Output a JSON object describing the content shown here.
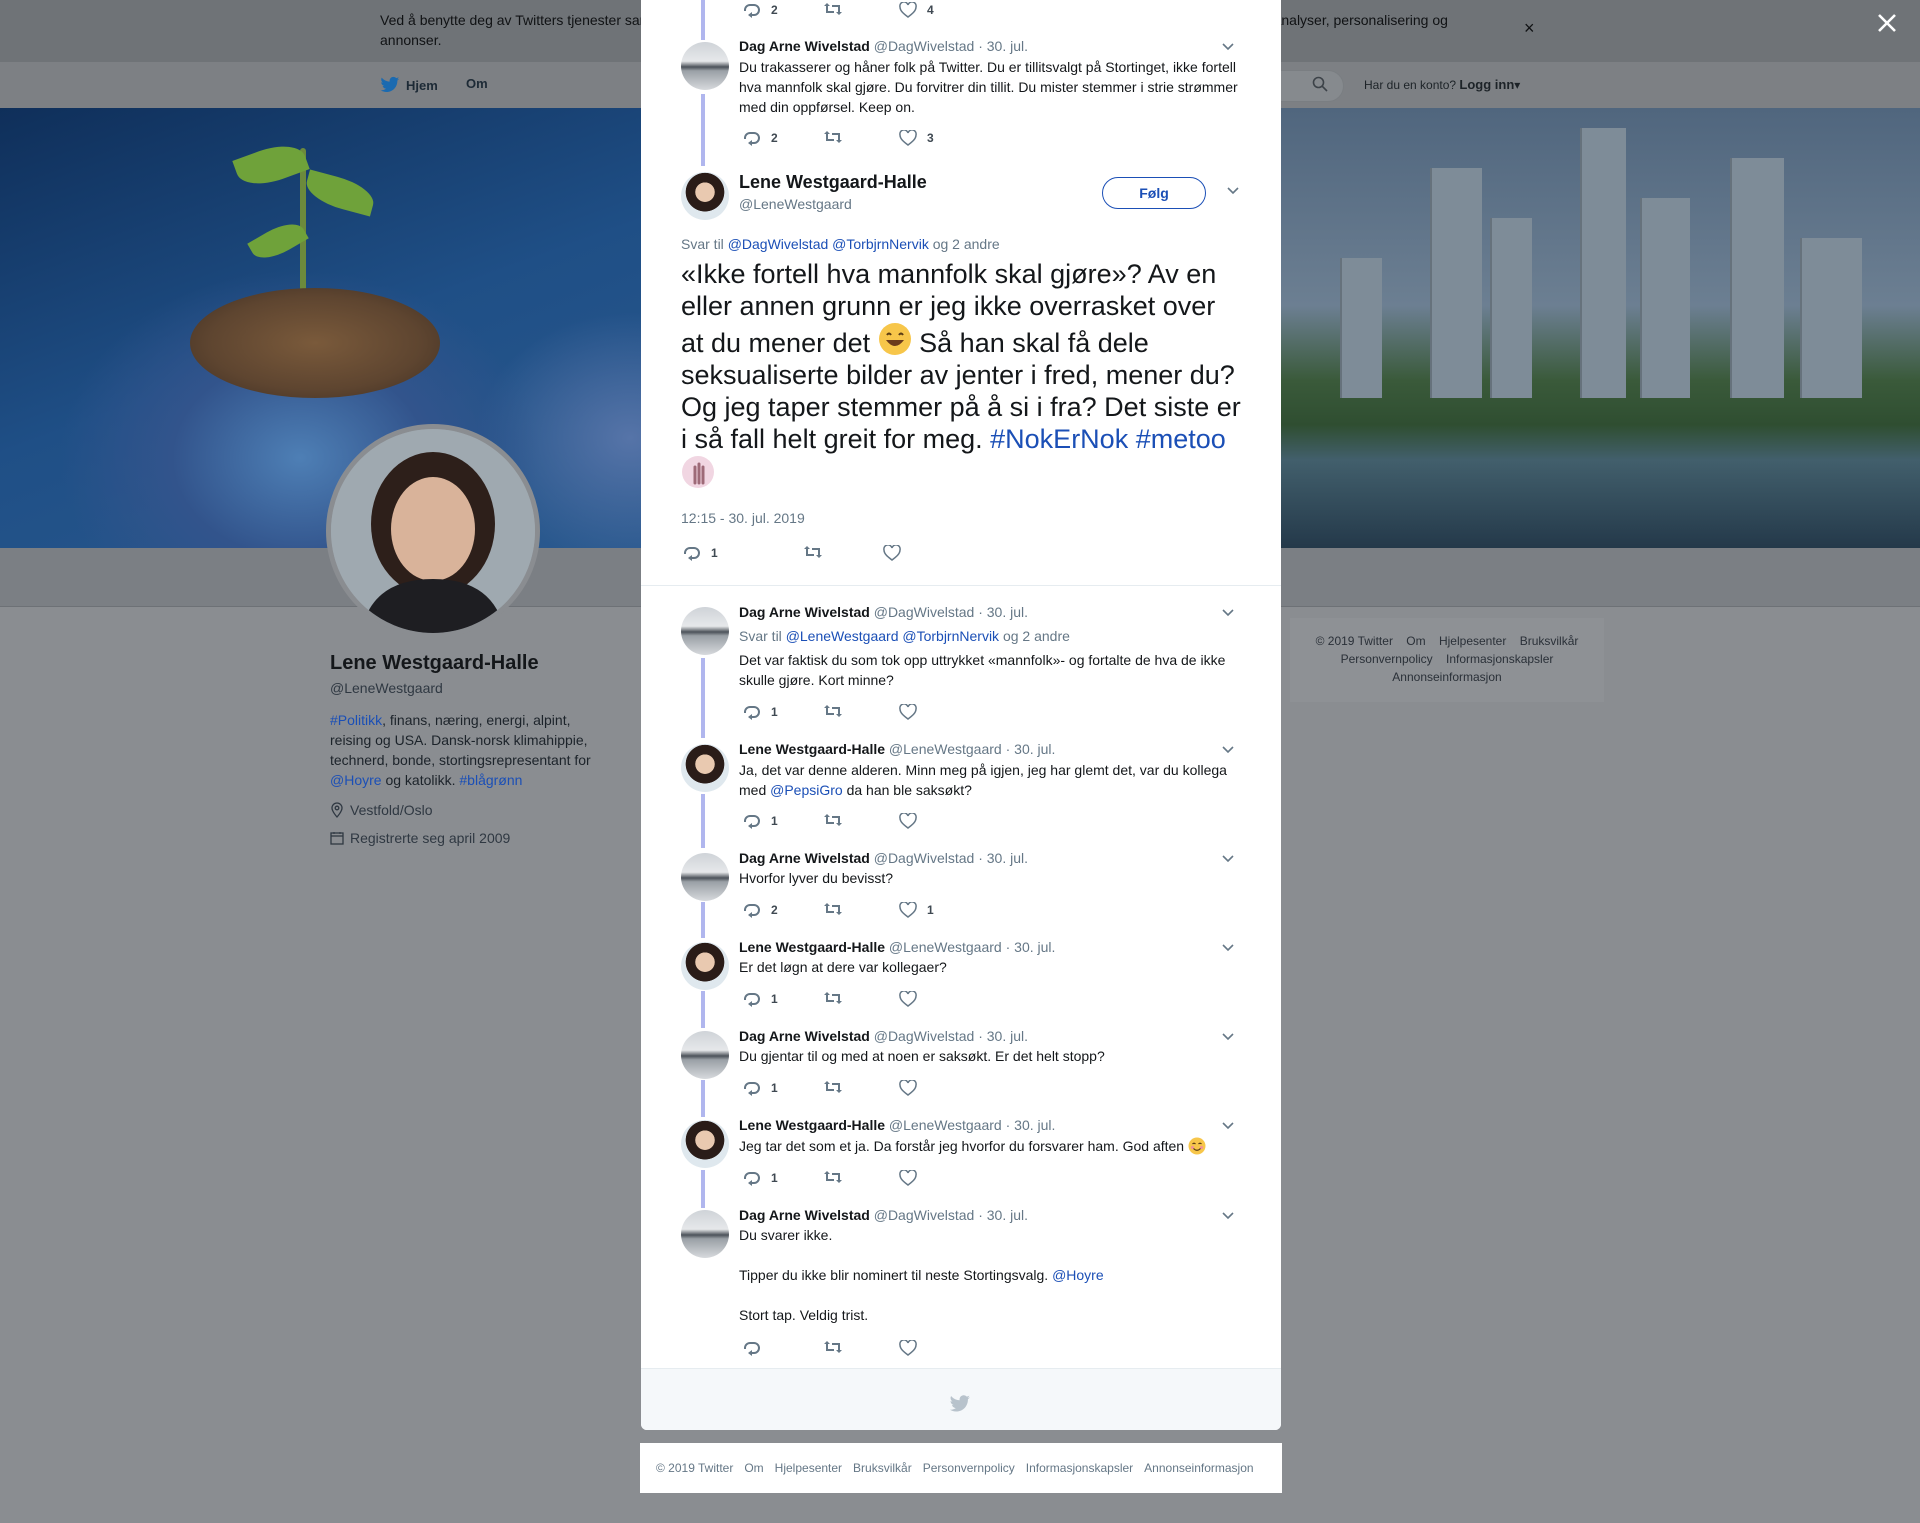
{
  "cookie_banner": {
    "text": "Ved å benytte deg av Twitters tjenester samtykker du i vår bruk av informasjonskapsler. Vi og våre partnere benytter informasjonskapsler til bl.a. analyser, personalisering og annonser.",
    "close": "×"
  },
  "nav": {
    "home": "Hjem",
    "about": "Om",
    "login_question": "Har du en konto?",
    "login": "Logg inn"
  },
  "profile": {
    "name": "Lene Westgaard-Halle",
    "handle": "@LeneWestgaard",
    "bio_parts": {
      "tag1": "#Politikk",
      "text1": ", finans, næring, energi, alpint, reising og USA. Dansk-norsk klimahippie, technerd, bonde, stortingsrepresentant for ",
      "mention": "@Hoyre",
      "text2": " og katolikk. ",
      "tag2": "#blågrønn"
    },
    "location": "Vestfold/Oslo",
    "joined": "Registrerte seg april 2009"
  },
  "side_footer": [
    "© 2019 Twitter",
    "Om",
    "Hjelpesenter",
    "Bruksvilkår",
    "Personvernpolicy",
    "Informasjonskapsler",
    "Annonseinformasjon"
  ],
  "tweets": [
    {
      "name": "Dag Arne Wivelstad",
      "handle": "@DagWivelstad",
      "date": "· 30. jul.",
      "text": "Du trakasserer og håner folk på Twitter. Du er tillitsvalgt på Stortinget, ikke fortell hva mannfolk skal gjøre. Du forvitrer din tillit. Du mister stemmer i strie strømmer med din oppførsel. Keep on.",
      "replies": "2",
      "retweets": "",
      "likes": "3"
    }
  ],
  "prev_tweet_counts": {
    "replies": "2",
    "likes": "4"
  },
  "main_tweet": {
    "name": "Lene Westgaard-Halle",
    "handle": "@LeneWestgaard",
    "follow": "Følg",
    "reply_to_prefix": "Svar til",
    "reply_to_mentions": "@DagWivelstad @TorbjrnNervik",
    "reply_to_suffix": "og 2 andre",
    "text": "«Ikke fortell hva mannfolk skal gjøre»? Av en eller annen grunn er jeg ikke overrasket over at du mener det",
    "text2": "Så han skal få dele seksualiserte bilder av jenter i fred, mener du? Og jeg taper stemmer på å si i fra? Det siste er i så fall helt greit for meg.",
    "hashtag1": "#NokErNok",
    "hashtag2": "#metoo",
    "time": "12:15 - 30. jul. 2019",
    "replies": "1"
  },
  "replies": [
    {
      "name": "Dag Arne Wivelstad",
      "handle": "@DagWivelstad",
      "date": "· 30. jul.",
      "reply_prefix": "Svar til",
      "reply_mentions": "@LeneWestgaard @TorbjrnNervik",
      "reply_suffix": "og 2 andre",
      "text": "Det var faktisk du som tok opp uttrykket «mannfolk»- og fortalte de hva de ikke skulle gjøre. Kort minne?",
      "replies": "1",
      "likes": ""
    },
    {
      "name": "Lene Westgaard-Halle",
      "handle": "@LeneWestgaard",
      "date": "· 30. jul.",
      "text_pre": "Ja, det var denne alderen. Minn meg på igjen, jeg har glemt det, var du kollega med ",
      "mention": "@PepsiGro",
      "text_post": " da han ble saksøkt?",
      "replies": "1",
      "likes": ""
    },
    {
      "name": "Dag Arne Wivelstad",
      "handle": "@DagWivelstad",
      "date": "· 30. jul.",
      "text": "Hvorfor lyver du bevisst?",
      "replies": "2",
      "likes": "1"
    },
    {
      "name": "Lene Westgaard-Halle",
      "handle": "@LeneWestgaard",
      "date": "· 30. jul.",
      "text": "Er det løgn at dere var kollegaer?",
      "replies": "1",
      "likes": ""
    },
    {
      "name": "Dag Arne Wivelstad",
      "handle": "@DagWivelstad",
      "date": "· 30. jul.",
      "text": "Du gjentar til og med at noen er saksøkt. Er det helt stopp?",
      "replies": "1",
      "likes": ""
    },
    {
      "name": "Lene Westgaard-Halle",
      "handle": "@LeneWestgaard",
      "date": "· 30. jul.",
      "text": "Jeg tar det som et ja. Da forstår jeg hvorfor du forsvarer ham. God aften",
      "replies": "1",
      "likes": ""
    },
    {
      "name": "Dag Arne Wivelstad",
      "handle": "@DagWivelstad",
      "date": "· 30. jul.",
      "line1": "Du svarer ikke.",
      "line2": "Tipper du ikke blir nominert til neste Stortingsvalg.",
      "mention": "@Hoyre",
      "line3": "Stort tap. Veldig trist.",
      "replies": "",
      "likes": ""
    }
  ],
  "footer": [
    "© 2019 Twitter",
    "Om",
    "Hjelpesenter",
    "Bruksvilkår",
    "Personvernpolicy",
    "Informasjonskapsler",
    "Annonseinformasjon"
  ],
  "colors": {
    "link": "#1b4fb6",
    "thread_line": "#b0b6ee",
    "muted": "#657786"
  },
  "icons": [
    "reply-icon",
    "retweet-icon",
    "like-icon",
    "chevron-down-icon",
    "close-icon",
    "twitter-bird-icon",
    "search-icon",
    "location-icon",
    "calendar-icon"
  ]
}
